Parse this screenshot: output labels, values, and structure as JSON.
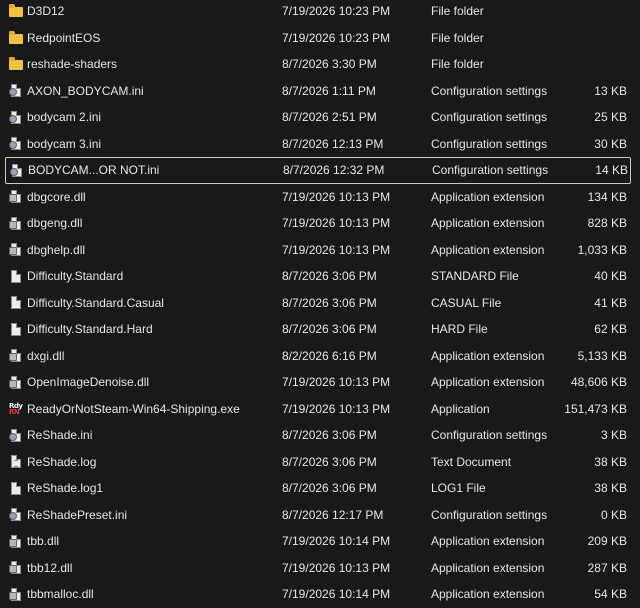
{
  "files": [
    {
      "name": "D3D12",
      "date": "7/19/2026 10:23 PM",
      "type": "File folder",
      "size": "",
      "icon": "folder-icon",
      "selected": false
    },
    {
      "name": "RedpointEOS",
      "date": "7/19/2026 10:23 PM",
      "type": "File folder",
      "size": "",
      "icon": "folder-icon",
      "selected": false
    },
    {
      "name": "reshade-shaders",
      "date": "8/7/2026 3:30 PM",
      "type": "File folder",
      "size": "",
      "icon": "folder-icon",
      "selected": false
    },
    {
      "name": "AXON_BODYCAM.ini",
      "date": "8/7/2026 1:11 PM",
      "type": "Configuration settings",
      "size": "13 KB",
      "icon": "settings-file-icon",
      "selected": false
    },
    {
      "name": "bodycam 2.ini",
      "date": "8/7/2026 2:51 PM",
      "type": "Configuration settings",
      "size": "25 KB",
      "icon": "settings-file-icon",
      "selected": false
    },
    {
      "name": "bodycam 3.ini",
      "date": "8/7/2026 12:13 PM",
      "type": "Configuration settings",
      "size": "30 KB",
      "icon": "settings-file-icon",
      "selected": false
    },
    {
      "name": "BODYCAM...OR NOT.ini",
      "date": "8/7/2026 12:32 PM",
      "type": "Configuration settings",
      "size": "14 KB",
      "icon": "settings-file-icon",
      "selected": true
    },
    {
      "name": "dbgcore.dll",
      "date": "7/19/2026 10:13 PM",
      "type": "Application extension",
      "size": "134 KB",
      "icon": "dll-file-icon",
      "selected": false
    },
    {
      "name": "dbgeng.dll",
      "date": "7/19/2026 10:13 PM",
      "type": "Application extension",
      "size": "828 KB",
      "icon": "dll-file-icon",
      "selected": false
    },
    {
      "name": "dbghelp.dll",
      "date": "7/19/2026 10:13 PM",
      "type": "Application extension",
      "size": "1,033 KB",
      "icon": "dll-file-icon",
      "selected": false
    },
    {
      "name": "Difficulty.Standard",
      "date": "8/7/2026 3:06 PM",
      "type": "STANDARD File",
      "size": "40 KB",
      "icon": "file-icon",
      "selected": false
    },
    {
      "name": "Difficulty.Standard.Casual",
      "date": "8/7/2026 3:06 PM",
      "type": "CASUAL File",
      "size": "41 KB",
      "icon": "file-icon",
      "selected": false
    },
    {
      "name": "Difficulty.Standard.Hard",
      "date": "8/7/2026 3:06 PM",
      "type": "HARD File",
      "size": "62 KB",
      "icon": "file-icon",
      "selected": false
    },
    {
      "name": "dxgi.dll",
      "date": "8/2/2026 6:16 PM",
      "type": "Application extension",
      "size": "5,133 KB",
      "icon": "dll-file-icon",
      "selected": false
    },
    {
      "name": "OpenImageDenoise.dll",
      "date": "7/19/2026 10:13 PM",
      "type": "Application extension",
      "size": "48,606 KB",
      "icon": "dll-file-icon",
      "selected": false
    },
    {
      "name": "ReadyOrNotSteam-Win64-Shipping.exe",
      "date": "7/19/2026 10:13 PM",
      "type": "Application",
      "size": "151,473 KB",
      "icon": "ready-or-not-app-icon",
      "selected": false
    },
    {
      "name": "ReShade.ini",
      "date": "8/7/2026 3:06 PM",
      "type": "Configuration settings",
      "size": "3 KB",
      "icon": "settings-file-icon",
      "selected": false
    },
    {
      "name": "ReShade.log",
      "date": "8/7/2026 3:06 PM",
      "type": "Text Document",
      "size": "38 KB",
      "icon": "text-file-icon",
      "selected": false
    },
    {
      "name": "ReShade.log1",
      "date": "8/7/2026 3:06 PM",
      "type": "LOG1 File",
      "size": "38 KB",
      "icon": "file-icon",
      "selected": false
    },
    {
      "name": "ReShadePreset.ini",
      "date": "8/7/2026 12:17 PM",
      "type": "Configuration settings",
      "size": "0 KB",
      "icon": "settings-file-icon",
      "selected": false
    },
    {
      "name": "tbb.dll",
      "date": "7/19/2026 10:14 PM",
      "type": "Application extension",
      "size": "209 KB",
      "icon": "dll-file-icon",
      "selected": false
    },
    {
      "name": "tbb12.dll",
      "date": "7/19/2026 10:13 PM",
      "type": "Application extension",
      "size": "287 KB",
      "icon": "dll-file-icon",
      "selected": false
    },
    {
      "name": "tbbmalloc.dll",
      "date": "7/19/2026 10:14 PM",
      "type": "Application extension",
      "size": "54 KB",
      "icon": "dll-file-icon",
      "selected": false
    }
  ],
  "exe_icon_text": {
    "top": "Rdy",
    "bottom": "RN"
  },
  "colors": {
    "background": "#191919",
    "text": "#e6e6e6",
    "folder": "#f0c040",
    "selection_border": "#c9c9c9"
  }
}
